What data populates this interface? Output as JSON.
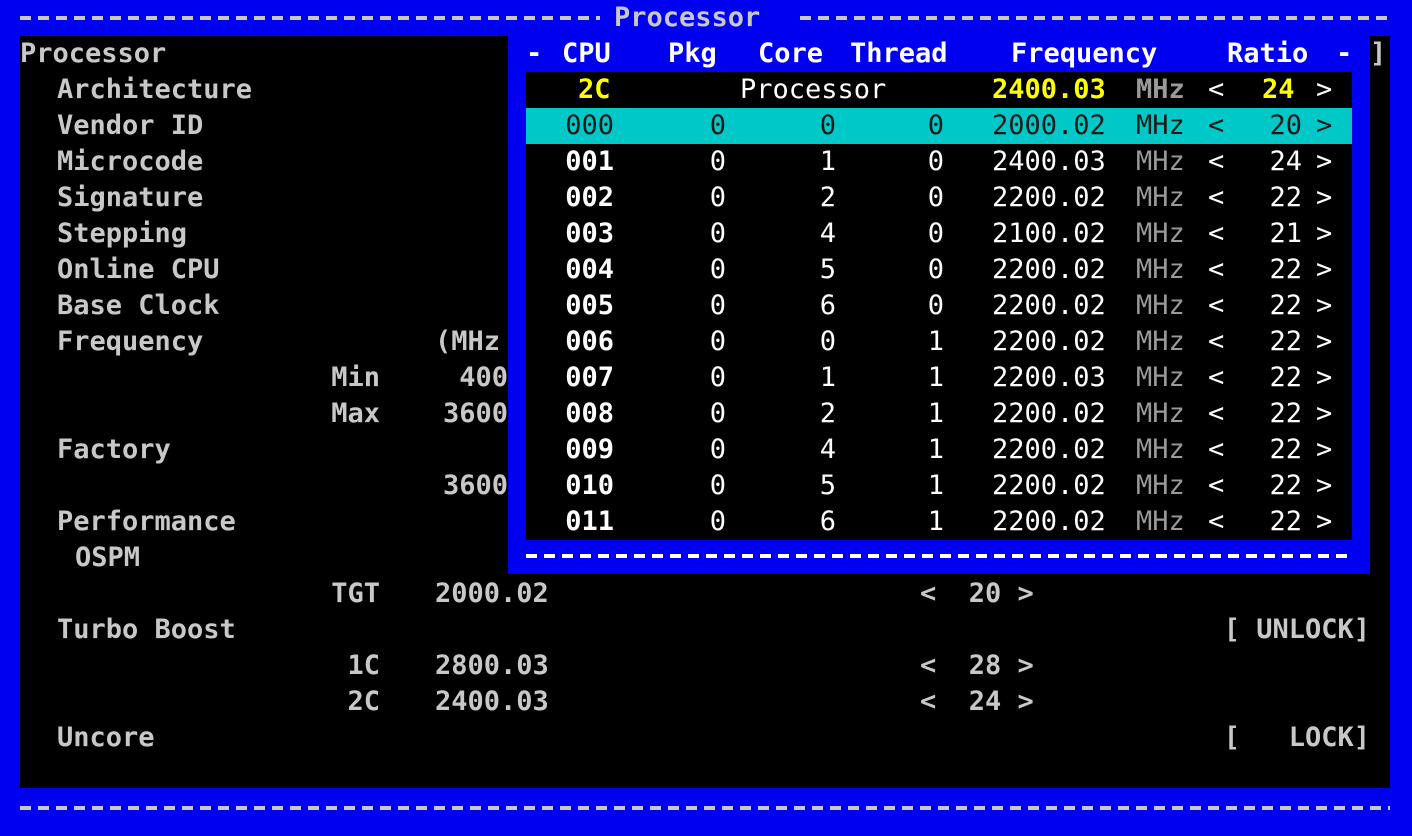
{
  "window": {
    "title": "Processor"
  },
  "left": {
    "section_title": "Processor",
    "labels": {
      "architecture": "Architecture",
      "vendor_id": "Vendor ID",
      "microcode": "Microcode",
      "signature": "Signature",
      "stepping": "Stepping",
      "online_cpu": "Online CPU",
      "base_clock": "Base Clock",
      "frequency": "Frequency",
      "frequency_unit": "(MHz",
      "min_label": "Min",
      "min_value": "400",
      "max_label": "Max",
      "max_value": "3600",
      "factory": "Factory",
      "factory_value": "3600",
      "performance": "Performance",
      "ospm": "OSPM",
      "tgt_label": "TGT",
      "tgt_value": "2000.02",
      "tgt_ratio": "<  20 >",
      "turbo_boost": "Turbo Boost",
      "turbo_state": "[ UNLOCK]",
      "c1_label": "1C",
      "c1_value": "2800.03",
      "c1_ratio": "<  28 >",
      "c2_label": "2C",
      "c2_value": "2400.03",
      "c2_ratio": "<  24 >",
      "uncore": "Uncore",
      "uncore_state": "[   LOCK]"
    },
    "right_bracket": "]"
  },
  "popup": {
    "headers": {
      "lead": "-",
      "cpu": "CPU",
      "pkg": "Pkg",
      "core": "Core",
      "thread": "Thread",
      "frequency": "Frequency",
      "ratio": "Ratio",
      "trail": "-"
    },
    "summary": {
      "cpu": "2C",
      "label": "Processor",
      "freq": "2400.03",
      "unit": "MHz",
      "lt": "<",
      "ratio": "24",
      "gt": ">"
    },
    "rows": [
      {
        "cpu": "000",
        "pkg": "0",
        "core": "0",
        "thread": "0",
        "freq": "2000.02",
        "unit": "MHz",
        "lt": "<",
        "ratio": "20",
        "gt": ">",
        "selected": true
      },
      {
        "cpu": "001",
        "pkg": "0",
        "core": "1",
        "thread": "0",
        "freq": "2400.03",
        "unit": "MHz",
        "lt": "<",
        "ratio": "24",
        "gt": ">"
      },
      {
        "cpu": "002",
        "pkg": "0",
        "core": "2",
        "thread": "0",
        "freq": "2200.02",
        "unit": "MHz",
        "lt": "<",
        "ratio": "22",
        "gt": ">"
      },
      {
        "cpu": "003",
        "pkg": "0",
        "core": "4",
        "thread": "0",
        "freq": "2100.02",
        "unit": "MHz",
        "lt": "<",
        "ratio": "21",
        "gt": ">"
      },
      {
        "cpu": "004",
        "pkg": "0",
        "core": "5",
        "thread": "0",
        "freq": "2200.02",
        "unit": "MHz",
        "lt": "<",
        "ratio": "22",
        "gt": ">"
      },
      {
        "cpu": "005",
        "pkg": "0",
        "core": "6",
        "thread": "0",
        "freq": "2200.02",
        "unit": "MHz",
        "lt": "<",
        "ratio": "22",
        "gt": ">"
      },
      {
        "cpu": "006",
        "pkg": "0",
        "core": "0",
        "thread": "1",
        "freq": "2200.02",
        "unit": "MHz",
        "lt": "<",
        "ratio": "22",
        "gt": ">"
      },
      {
        "cpu": "007",
        "pkg": "0",
        "core": "1",
        "thread": "1",
        "freq": "2200.03",
        "unit": "MHz",
        "lt": "<",
        "ratio": "22",
        "gt": ">"
      },
      {
        "cpu": "008",
        "pkg": "0",
        "core": "2",
        "thread": "1",
        "freq": "2200.02",
        "unit": "MHz",
        "lt": "<",
        "ratio": "22",
        "gt": ">"
      },
      {
        "cpu": "009",
        "pkg": "0",
        "core": "4",
        "thread": "1",
        "freq": "2200.02",
        "unit": "MHz",
        "lt": "<",
        "ratio": "22",
        "gt": ">"
      },
      {
        "cpu": "010",
        "pkg": "0",
        "core": "5",
        "thread": "1",
        "freq": "2200.02",
        "unit": "MHz",
        "lt": "<",
        "ratio": "22",
        "gt": ">"
      },
      {
        "cpu": "011",
        "pkg": "0",
        "core": "6",
        "thread": "1",
        "freq": "2200.02",
        "unit": "MHz",
        "lt": "<",
        "ratio": "22",
        "gt": ">"
      }
    ]
  },
  "colors": {
    "frame_blue": "#0000f0",
    "panel_black": "#000000",
    "highlight_cyan": "#00c8c8",
    "value_yellow": "#ffff00",
    "label_gray": "#c8c8c8"
  }
}
